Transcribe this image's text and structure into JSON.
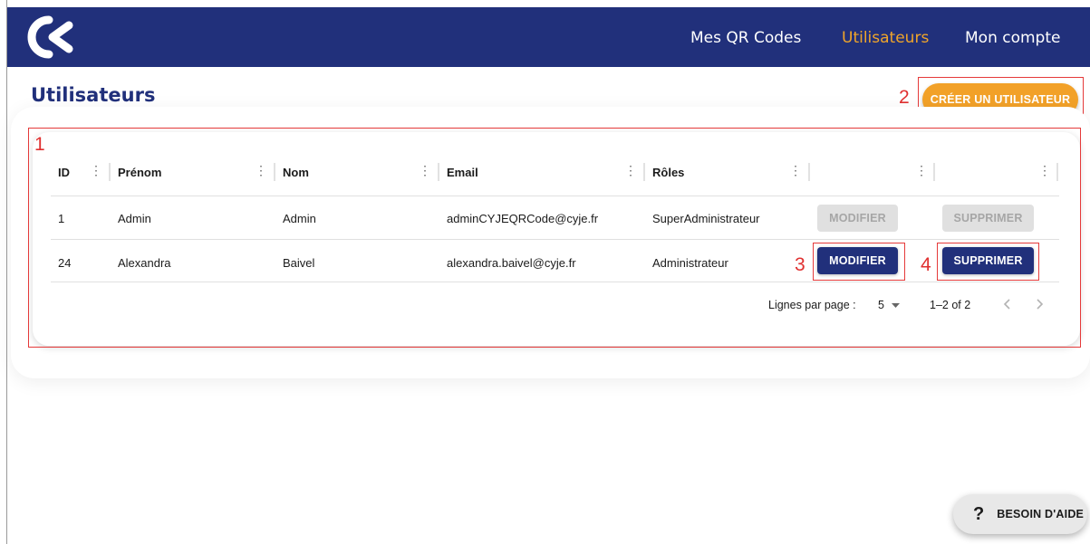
{
  "header": {
    "nav": {
      "qr_codes": "Mes QR Codes",
      "users": "Utilisateurs",
      "account": "Mon compte"
    },
    "accent_color": "#f0a52a",
    "brand_color": "#21307b"
  },
  "page": {
    "title": "Utilisateurs",
    "create_button": "CRÉER UN UTILISATEUR"
  },
  "annotations": [
    "1",
    "2",
    "3",
    "4"
  ],
  "table": {
    "columns": [
      "ID",
      "Prénom",
      "Nom",
      "Email",
      "Rôles",
      "",
      ""
    ],
    "rows": [
      {
        "id": "1",
        "first_name": "Admin",
        "last_name": "Admin",
        "email": "adminCYJEQRCode@cyje.fr",
        "role": "SuperAdministrateur",
        "edit": "MODIFIER",
        "delete": "SUPPRIMER",
        "buttons_enabled": false
      },
      {
        "id": "24",
        "first_name": "Alexandra",
        "last_name": "Baivel",
        "email": "alexandra.baivel@cyje.fr",
        "role": "Administrateur",
        "edit": "MODIFIER",
        "delete": "SUPPRIMER",
        "buttons_enabled": true
      }
    ]
  },
  "pagination": {
    "rows_per_page_label": "Lignes par page :",
    "rows_per_page_value": "5",
    "range": "1–2 of 2"
  },
  "help_button": {
    "icon": "question-icon",
    "label": "BESOIN D'AIDE"
  }
}
